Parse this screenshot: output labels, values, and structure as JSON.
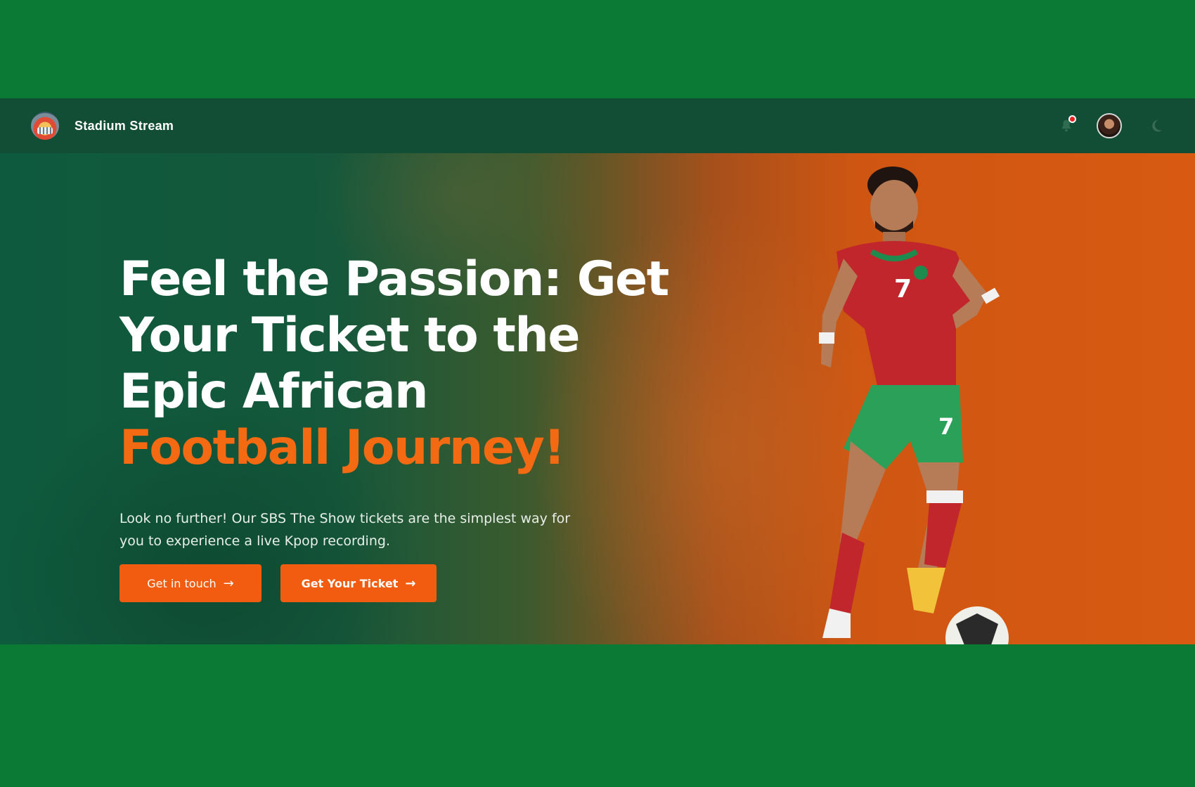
{
  "header": {
    "brand": "Stadium Stream",
    "icons": [
      "stadium-logo",
      "bell-icon",
      "avatar",
      "moon-icon"
    ]
  },
  "hero": {
    "title_line1": "Feel the Passion: Get Your Ticket to the Epic African",
    "title_accent": "Football Journey!",
    "description": "Look no further! Our SBS The Show tickets are the simplest way for you to experience a live Kpop recording.",
    "buttons": {
      "get_in_touch": "Get in touch",
      "get_ticket": "Get Your Ticket"
    }
  },
  "colors": {
    "page_bg": "#0b7a34",
    "navbar_bg": "#124d35",
    "accent": "#f36a12",
    "button_bg": "#f25c10"
  }
}
